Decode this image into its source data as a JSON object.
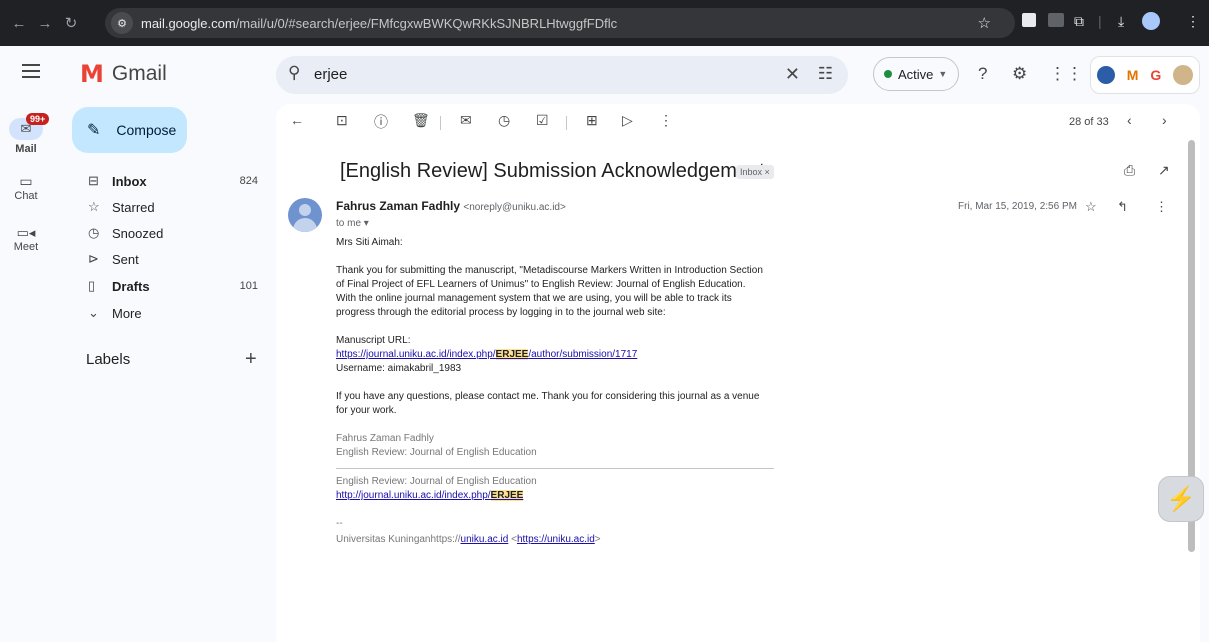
{
  "browser": {
    "url_host": "mail.google.com",
    "url_path": "/mail/u/0/#search/erjee/FMfcgxwBWKQwRKkSJNBRLHtwggfFDflc"
  },
  "header": {
    "app_name": "Gmail",
    "search_value": "erjee",
    "status_label": "Active"
  },
  "brand_badge": {
    "letters": [
      "M",
      "G"
    ]
  },
  "rail": {
    "badge": "99+",
    "items": [
      {
        "label": "Mail"
      },
      {
        "label": "Chat"
      },
      {
        "label": "Meet"
      }
    ]
  },
  "sidebar": {
    "compose_label": "Compose",
    "items": [
      {
        "label": "Inbox",
        "count": "824",
        "bold": true
      },
      {
        "label": "Starred",
        "count": ""
      },
      {
        "label": "Snoozed",
        "count": ""
      },
      {
        "label": "Sent",
        "count": ""
      },
      {
        "label": "Drafts",
        "count": "101",
        "bold": true
      },
      {
        "label": "More",
        "count": ""
      }
    ],
    "labels_title": "Labels"
  },
  "toolbar": {
    "counter": "28 of 33"
  },
  "message": {
    "subject": "[English Review] Submission Acknowledgement",
    "chip": "Inbox ×",
    "sender_name": "Fahrus Zaman Fadhly",
    "sender_email": "<noreply@uniku.ac.id>",
    "to": "to me ▾",
    "date": "Fri, Mar 15, 2019, 2:56 PM",
    "greeting": "Mrs Siti Aimah:",
    "para1": "Thank you for submitting the manuscript, \"Metadiscourse Markers Written in Introduction Section of Final Project of EFL Learners of Unimus\" to English Review: Journal of English Education. With the online journal management system that we are using, you will be able to track its progress through the editorial process by logging in to the journal web site:",
    "manuscript_label": "Manuscript URL:",
    "manuscript_url_a": "https://journal.uniku.ac.id/index.php/",
    "manuscript_url_hl": "ERJEE",
    "manuscript_url_b": "/author/submission/1717",
    "username": "Username: aimakabril_1983",
    "para3": "If you have any questions, please contact me. Thank you for considering this journal as a venue for your work.",
    "sig_name": "Fahrus Zaman Fadhly",
    "sig_journal": "English Review: Journal of English Education",
    "footer_journal": "English Review: Journal of English Education",
    "footer_url_a": "http://journal.uniku.ac.id/index.php/",
    "footer_url_hl": "ERJEE",
    "dashes": "--",
    "univ_text": "Universitas Kuninganhttps://",
    "univ_link1": "uniku.ac.id",
    "univ_lt": " <",
    "univ_link2": "https://uniku.ac.id",
    "univ_gt": ">"
  }
}
